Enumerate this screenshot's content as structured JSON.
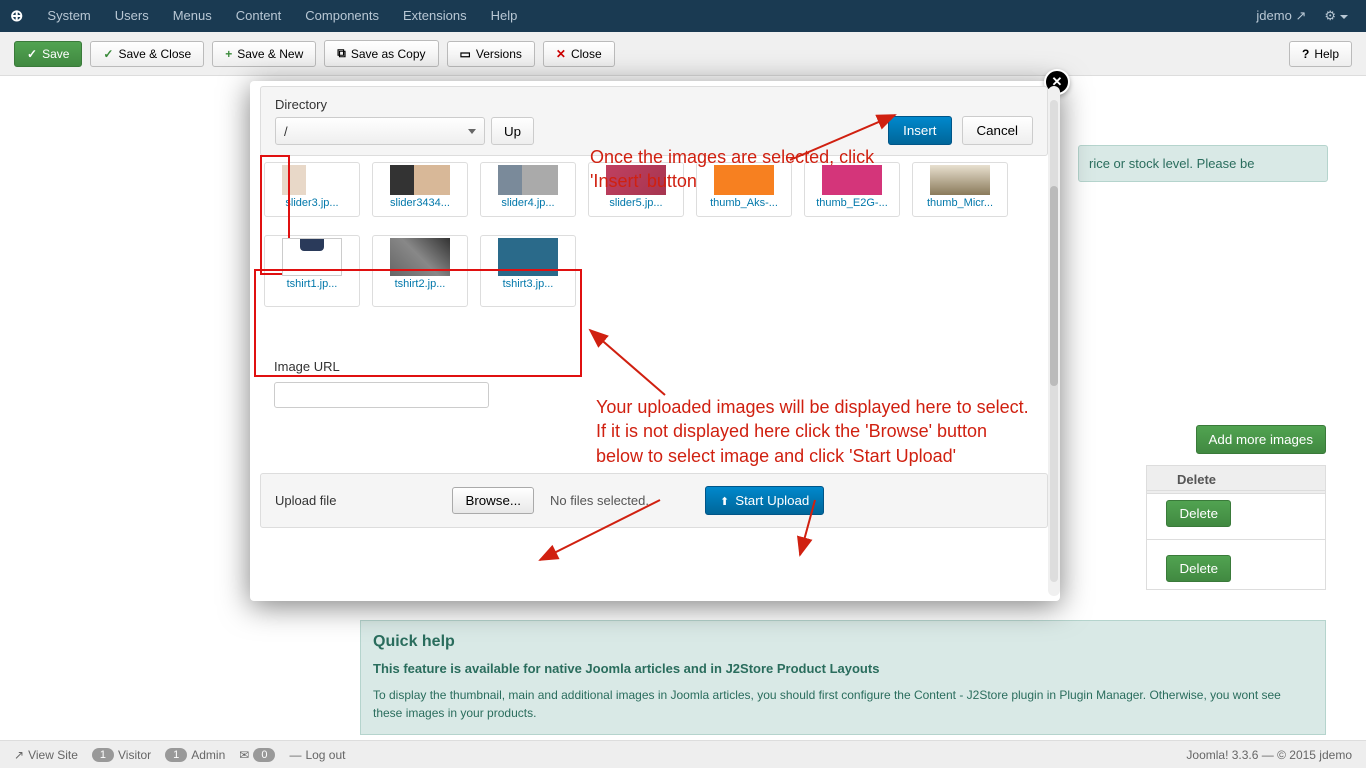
{
  "topnav": {
    "items": [
      "System",
      "Users",
      "Menus",
      "Content",
      "Components",
      "Extensions",
      "Help"
    ],
    "user": "jdemo"
  },
  "toolbar": {
    "save": "Save",
    "save_close": "Save & Close",
    "save_new": "Save & New",
    "save_copy": "Save as Copy",
    "versions": "Versions",
    "close": "Close",
    "help": "Help"
  },
  "info_box": "rice or stock level. Please be",
  "images_panel": {
    "add_more": "Add more images",
    "delete_header": "Delete",
    "delete_btn": "Delete"
  },
  "quickhelp": {
    "title": "Quick help",
    "subtitle": "This feature is available for native Joomla articles and in J2Store Product Layouts",
    "body": "To display the thumbnail, main and additional images in Joomla articles, you should first configure the Content - J2Store plugin in Plugin Manager. Otherwise, you wont see these images in your products."
  },
  "statusbar": {
    "view_site": "View Site",
    "visitor_count": "1",
    "visitor": "Visitor",
    "admin_count": "1",
    "admin": "Admin",
    "msg_count": "0",
    "logout": "Log out",
    "footer": "Joomla! 3.3.6 — © 2015 jdemo"
  },
  "modal": {
    "directory_label": "Directory",
    "directory_value": "/",
    "up": "Up",
    "insert": "Insert",
    "cancel": "Cancel",
    "thumbs_row1": [
      {
        "label": "slider3.jp...",
        "cls": "img-slider1"
      },
      {
        "label": "slider3434...",
        "cls": "img-slider2"
      },
      {
        "label": "slider4.jp...",
        "cls": "img-slider3"
      },
      {
        "label": "slider5.jp...",
        "cls": "img-slider4"
      },
      {
        "label": "thumb_Aks-...",
        "cls": "img-slider5"
      },
      {
        "label": "thumb_E2G-...",
        "cls": "img-thumb1"
      },
      {
        "label": "thumb_Micr...",
        "cls": "img-thumb2"
      }
    ],
    "thumbs_row2": [
      {
        "label": "tshirt1.jp...",
        "cls": "img-tshirt1"
      },
      {
        "label": "tshirt2.jp...",
        "cls": "img-tshirt2"
      },
      {
        "label": "tshirt3.jp...",
        "cls": "img-tshirt3"
      }
    ],
    "image_url_label": "Image URL",
    "image_url_value": "",
    "upload_label": "Upload file",
    "browse": "Browse...",
    "no_files": "No files selected.",
    "start_upload": "Start Upload"
  },
  "annotations": {
    "insert_note": "Once the images are selected, click 'Insert' button",
    "display_note": "Your uploaded images will be displayed here to select. If it is not displayed here click the 'Browse' button below to select image and click 'Start Upload'"
  }
}
